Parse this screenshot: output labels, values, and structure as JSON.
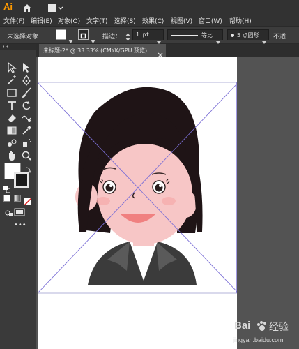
{
  "app": {
    "logo": "Ai",
    "logo_color": "#ff9a00",
    "home_icon": "home-icon",
    "workspace_icon": "workspace-switcher-icon"
  },
  "menu": {
    "items": [
      "文件(F)",
      "编辑(E)",
      "对象(O)",
      "文字(T)",
      "选择(S)",
      "效果(C)",
      "视图(V)",
      "窗口(W)",
      "帮助(H)"
    ]
  },
  "control_bar": {
    "selection_state": "未选择对象",
    "stroke_label": "描边：",
    "stroke_value": "1 pt",
    "stroke_style": "等比",
    "brush_value": "5 点圆形",
    "opacity_label": "不透"
  },
  "document": {
    "tab_label": "未标题-2* @ 33.33% (CMYK/GPU 预览)",
    "close_icon": "close-icon"
  },
  "colors": {
    "hair": "#1f1416",
    "skin": "#f7c6c6",
    "jacket": "#3b3b3b",
    "mouth": "#f08080",
    "guide": "#7b6fd6"
  },
  "watermark": {
    "brand": "Bai",
    "brand2": "经验",
    "url": "jingyan.baidu.com"
  }
}
